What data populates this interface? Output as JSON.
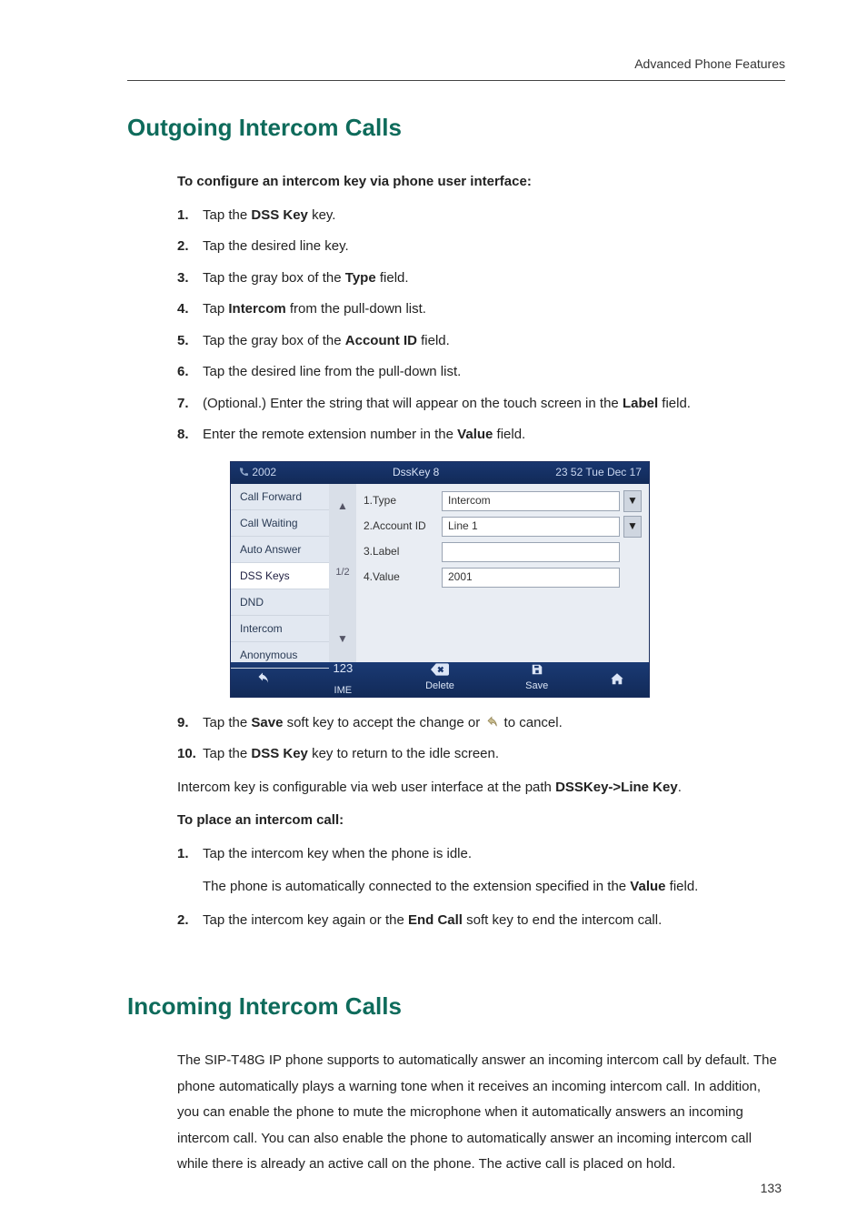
{
  "header": {
    "right": "Advanced Phone Features"
  },
  "section1": {
    "title": "Outgoing Intercom Calls"
  },
  "intro1": {
    "heading": "To configure an intercom key via phone user interface:",
    "steps": [
      {
        "n": "1.",
        "pre": "Tap the ",
        "b": "DSS Key",
        "post": " key."
      },
      {
        "n": "2.",
        "pre": "Tap the desired line key.",
        "b": "",
        "post": ""
      },
      {
        "n": "3.",
        "pre": "Tap the gray box of the ",
        "b": "Type",
        "post": " field."
      },
      {
        "n": "4.",
        "pre": "Tap ",
        "b": "Intercom",
        "post": " from the pull-down list."
      },
      {
        "n": "5.",
        "pre": "Tap the gray box of the ",
        "b": "Account ID",
        "post": " field."
      },
      {
        "n": "6.",
        "pre": "Tap the desired line from the pull-down list.",
        "b": "",
        "post": ""
      },
      {
        "n": "7.",
        "pre": "(Optional.) Enter the string that will appear on the touch screen in the ",
        "b": "Label",
        "post": " field."
      },
      {
        "n": "8.",
        "pre": "Enter the remote extension number in the ",
        "b": "Value",
        "post": " field."
      }
    ],
    "steps_after": [
      {
        "n": "9.",
        "pre": "Tap the ",
        "b": "Save",
        "mid": " soft key to accept the change or ",
        "post": " to cancel."
      },
      {
        "n": "10.",
        "pre": "Tap the ",
        "b": "DSS Key",
        "post": " key to return to the idle screen."
      }
    ],
    "note_pre": "Intercom key is configurable via web user interface at the path ",
    "note_b": "DSSKey->Line Key",
    "note_post": "."
  },
  "phone": {
    "ext": "2002",
    "title": "DssKey 8",
    "clock": "23 52 Tue Dec 17",
    "sidebar": [
      "Call Forward",
      "Call Waiting",
      "Auto Answer",
      "DSS Keys",
      "DND",
      "Intercom",
      "Anonymous"
    ],
    "active_index": 3,
    "page_indicator": "1/2",
    "fields": [
      {
        "label": "1.Type",
        "value": "Intercom",
        "dropdown": true
      },
      {
        "label": "2.Account ID",
        "value": "Line 1",
        "dropdown": true
      },
      {
        "label": "3.Label",
        "value": "",
        "dropdown": false
      },
      {
        "label": "4.Value",
        "value": "2001",
        "dropdown": false
      }
    ],
    "softkeys": {
      "ime_top": "123",
      "ime": "IME",
      "delete": "Delete",
      "save": "Save"
    }
  },
  "place": {
    "heading": "To place an intercom call:",
    "s1n": "1.",
    "s1": "Tap the intercom key when the phone is idle.",
    "s1b_pre": "The phone is automatically connected to the extension specified in the ",
    "s1b_b": "Value",
    "s1b_post": " field.",
    "s2n": "2.",
    "s2_pre": "Tap the intercom key again or the ",
    "s2_b": "End Call",
    "s2_post": " soft key to end the intercom call."
  },
  "section2": {
    "title": "Incoming Intercom Calls",
    "para": "The SIP-T48G IP phone supports to automatically answer an incoming intercom call by default. The phone automatically plays a warning tone when it receives an incoming intercom call. In addition, you can enable the phone to mute the microphone when it automatically answers an incoming intercom call. You can also enable the phone to automatically answer an incoming intercom call while there is already an active call on the phone. The active call is placed on hold."
  },
  "page_number": "133"
}
